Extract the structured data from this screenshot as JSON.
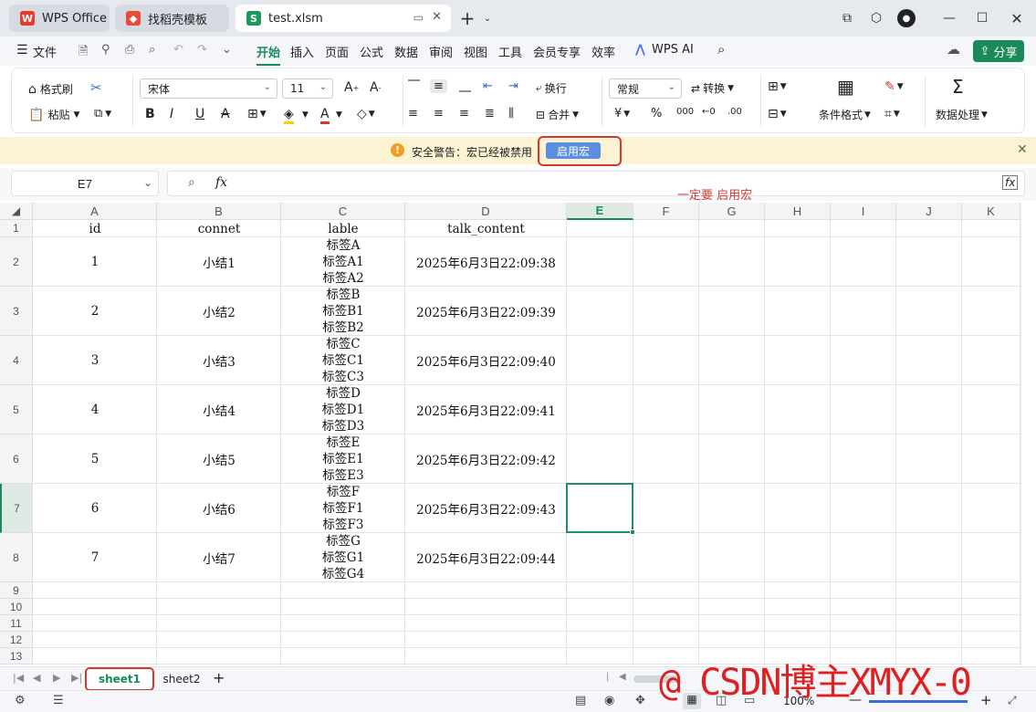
{
  "tabs": [
    {
      "label": "WPS Office",
      "icon": "wps-logo"
    },
    {
      "label": "找稻壳模板",
      "icon": "docer-logo"
    },
    {
      "label": "test.xlsm",
      "icon": "spreadsheet-s"
    }
  ],
  "titlebar_controls": [
    "new-tab-plus",
    "tab-list-chevron",
    "window-mode",
    "cube",
    "avatar",
    "minimize",
    "maximize",
    "close"
  ],
  "menu": {
    "file": "文件",
    "items": [
      "开始",
      "插入",
      "页面",
      "公式",
      "数据",
      "审阅",
      "视图",
      "工具",
      "会员专享",
      "效率"
    ],
    "active": "开始",
    "ai": "WPS AI",
    "share": "分享"
  },
  "ribbon": {
    "format_painter": "格式刷",
    "paste": "粘贴",
    "font": "宋体",
    "size": "11",
    "wrap": "换行",
    "merge": "合并",
    "number_format": "常规",
    "convert": "转换",
    "cond_format": "条件格式",
    "data_processing": "数据处理",
    "bold": "B",
    "italic": "I",
    "underline": "U",
    "strike": "A",
    "percent": "%",
    "currency": "¥"
  },
  "warning": {
    "text": "安全警告：宏已经被禁用",
    "button": "启用宏"
  },
  "name_box": "E7",
  "fx": "fx",
  "annotation": "一定要 启用宏",
  "columns": [
    "A",
    "B",
    "C",
    "D",
    "E",
    "F",
    "G",
    "H",
    "I",
    "J",
    "K"
  ],
  "active_cell": "E7",
  "row_numbers": [
    "1",
    "2",
    "3",
    "4",
    "5",
    "6",
    "7",
    "8",
    "9",
    "10",
    "11",
    "12",
    "13"
  ],
  "header_row": [
    "id",
    "connet",
    "lable",
    "talk_content"
  ],
  "rows": [
    {
      "id": "1",
      "connet": "小结1",
      "lable": [
        "标签A",
        "标签A1",
        "标签A2"
      ],
      "talk": "2025年6月3日22:09:38"
    },
    {
      "id": "2",
      "connet": "小结2",
      "lable": [
        "标签B",
        "标签B1",
        "标签B2"
      ],
      "talk": "2025年6月3日22:09:39"
    },
    {
      "id": "3",
      "connet": "小结3",
      "lable": [
        "标签C",
        "标签C1",
        "标签C3"
      ],
      "talk": "2025年6月3日22:09:40"
    },
    {
      "id": "4",
      "connet": "小结4",
      "lable": [
        "标签D",
        "标签D1",
        "标签D3"
      ],
      "talk": "2025年6月3日22:09:41"
    },
    {
      "id": "5",
      "connet": "小结5",
      "lable": [
        "标签E",
        "标签E1",
        "标签E3"
      ],
      "talk": "2025年6月3日22:09:42"
    },
    {
      "id": "6",
      "connet": "小结6",
      "lable": [
        "标签F",
        "标签F1",
        "标签F3"
      ],
      "talk": "2025年6月3日22:09:43"
    },
    {
      "id": "7",
      "connet": "小结7",
      "lable": [
        "标签G",
        "标签G1",
        "标签G4"
      ],
      "talk": "2025年6月3日22:09:44"
    }
  ],
  "sheets": [
    "sheet1",
    "sheet2"
  ],
  "active_sheet": "sheet1",
  "zoom": "100%",
  "watermark": "@ CSDN博主XMYX-0",
  "colors": {
    "accent": "#1a8a5a",
    "highlight": "#d33a2f",
    "selection": "#1f8f5f",
    "warn_bg": "#fbf3d4",
    "button_blue": "#5b8ee0"
  }
}
